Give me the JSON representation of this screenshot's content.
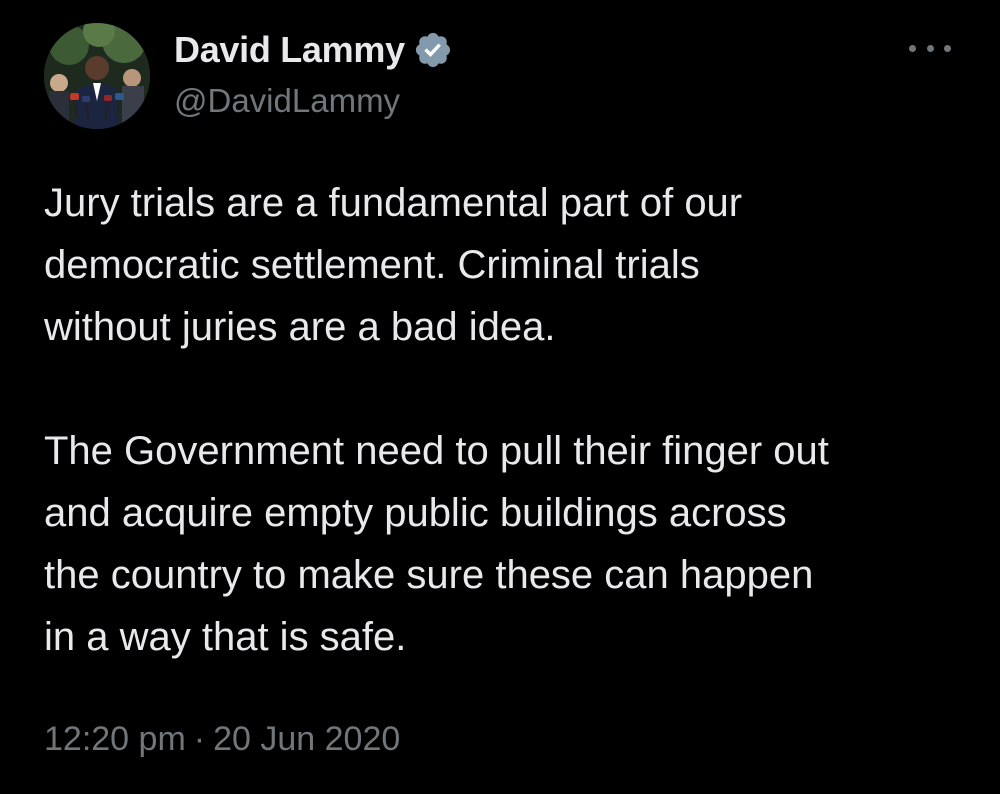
{
  "author": {
    "display_name": "David Lammy",
    "handle": "@DavidLammy",
    "verified_icon": "verified-badge-icon"
  },
  "tweet": {
    "paragraph_1": "Jury trials are a fundamental part of our\ndemocratic settlement. Criminal trials\nwithout juries are a bad idea.",
    "paragraph_2": "The Government need to pull their finger out\nand acquire empty public buildings across\nthe country to make sure these can happen\nin a way that is safe."
  },
  "meta": {
    "time": "12:20 pm",
    "separator": "·",
    "date": "20 Jun 2020"
  },
  "colors": {
    "background": "#000000",
    "text": "#e7e9ea",
    "secondary": "#71767b"
  }
}
